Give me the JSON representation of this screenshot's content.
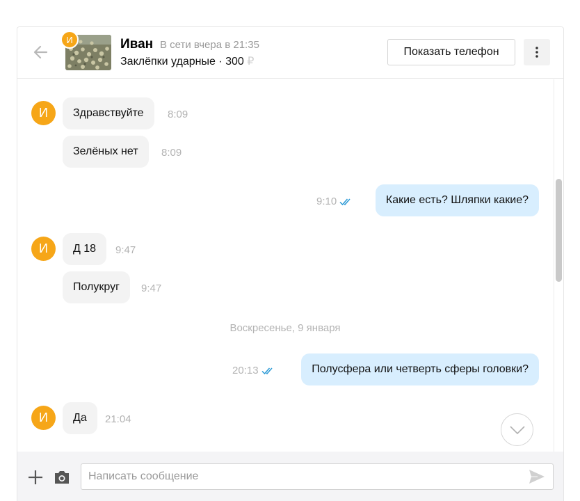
{
  "header": {
    "back_icon": "arrow-left-icon",
    "avatar_initial": "И",
    "name": "Иван",
    "status": "В сети вчера в 21:35",
    "listing_title": "Заклёпки ударные · 300",
    "listing_fade": " ₽",
    "show_phone_label": "Показать телефон",
    "more_icon": "kebab-menu-icon"
  },
  "chat": {
    "partial_top_text": "· ·· ·",
    "messages": [
      {
        "direction": "in",
        "avatar": "И",
        "text": "Здравствуйте",
        "time": "8:09"
      },
      {
        "direction": "in",
        "text": "Зелёных нет",
        "time": "8:09"
      },
      {
        "direction": "out",
        "text": "Какие есть? Шляпки  какие?",
        "time": "9:10",
        "read": true
      },
      {
        "direction": "in",
        "avatar": "И",
        "text": "Д 18",
        "time": "9:47"
      },
      {
        "direction": "in",
        "text": "Полукруг",
        "time": "9:47"
      },
      {
        "direction": "out",
        "text": "Полусфера или четверть сферы головки?",
        "time": "20:13",
        "read": true
      },
      {
        "direction": "in",
        "avatar": "И",
        "text": "Да",
        "time": "21:04"
      }
    ],
    "date_separator": "Воскресенье, 9 января",
    "scroll_down_icon": "chevron-down-icon"
  },
  "input": {
    "placeholder": "Написать сообщение",
    "value": "",
    "plus_icon": "plus-icon",
    "camera_icon": "camera-icon",
    "send_icon": "send-icon"
  },
  "colors": {
    "accent": "#f6a618",
    "outgoing_bubble": "#d8eefe",
    "incoming_bubble": "#f3f3f3",
    "read_check": "#2e9bd6"
  }
}
